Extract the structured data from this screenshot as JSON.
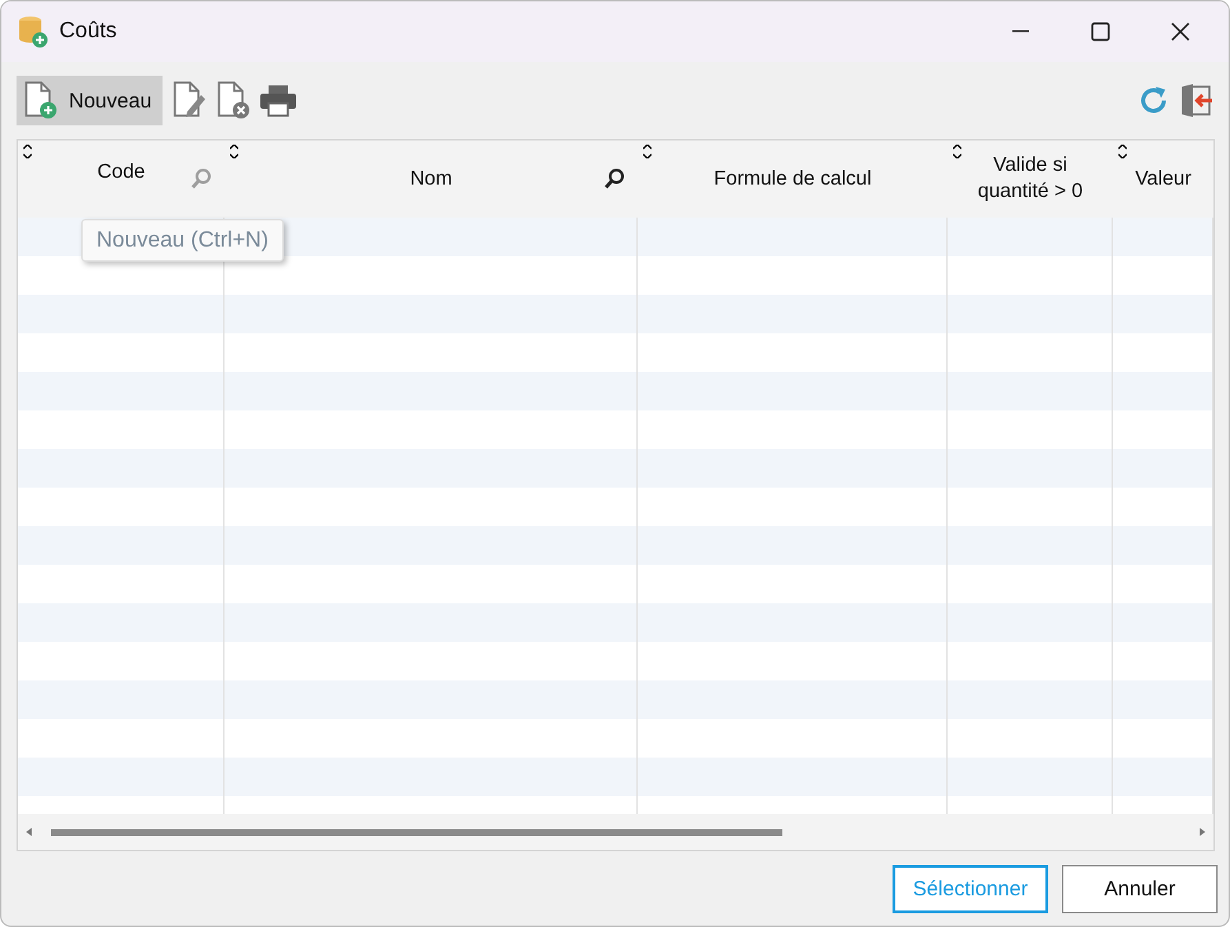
{
  "window": {
    "title": "Coûts"
  },
  "toolbar": {
    "new_button": {
      "label": "Nouveau",
      "selected": true
    },
    "tooltip": "Nouveau (Ctrl+N)"
  },
  "table": {
    "columns": [
      {
        "label": "Code",
        "searchable": true
      },
      {
        "label": "Nom",
        "searchable": true
      },
      {
        "label": "Formule de calcul",
        "searchable": false
      },
      {
        "label": "Valide si quantité > 0",
        "searchable": false
      },
      {
        "label": "Valeur",
        "searchable": false
      }
    ]
  },
  "buttons": [
    {
      "label": "Sélectionner",
      "kind": "primary"
    },
    {
      "label": "Annuler",
      "kind": "secondary"
    }
  ]
}
